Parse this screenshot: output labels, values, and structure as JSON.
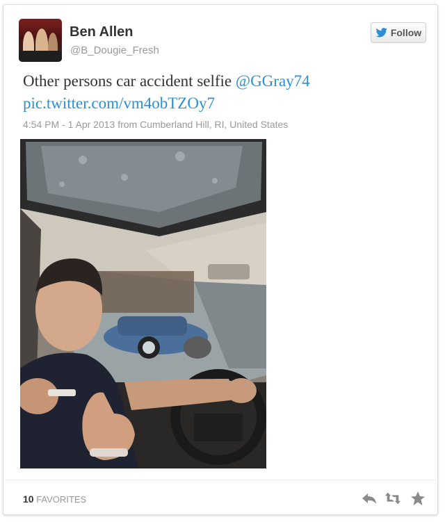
{
  "tweet": {
    "author_name": "Ben Allen",
    "author_handle": "@B_Dougie_Fresh",
    "follow_label": "Follow",
    "text_main": "Other persons car accident selfie ",
    "mention": "@GGray74",
    "pic_link": "pic.twitter.com/vm4obTZOy7",
    "timestamp": "4:54 PM - 1 Apr 2013 from Cumberland Hill, RI, United States",
    "favorites_count": "10",
    "favorites_label": "FAVORITES"
  },
  "icons": {
    "follow": "twitter-bird-icon",
    "reply": "reply-icon",
    "retweet": "retweet-icon",
    "favorite": "star-icon"
  },
  "colors": {
    "link": "#2b8fd6",
    "text": "#333333",
    "muted": "#999999",
    "follow_bird": "#2b8fd6"
  }
}
